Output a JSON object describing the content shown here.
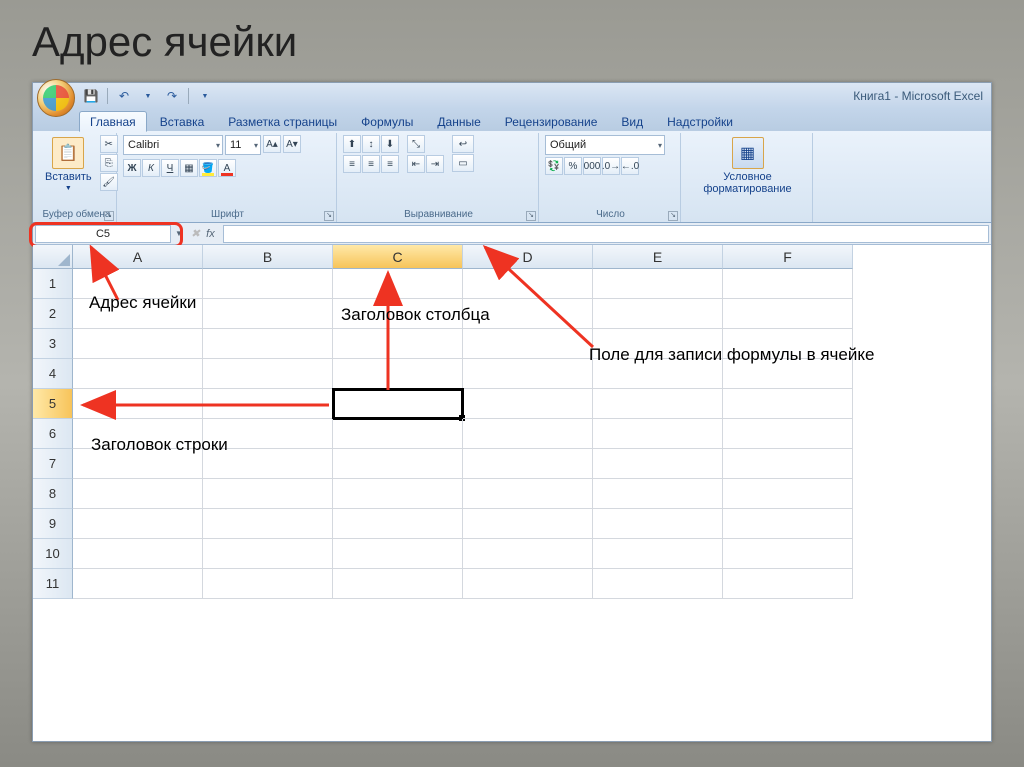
{
  "slide": {
    "title": "Адрес ячейки"
  },
  "titlebar": {
    "title": "Книга1 - Microsoft Excel"
  },
  "qat": {
    "save": "save",
    "undo": "undo",
    "redo": "redo"
  },
  "tabs": {
    "home": "Главная",
    "insert": "Вставка",
    "layout": "Разметка страницы",
    "formulas": "Формулы",
    "data": "Данные",
    "review": "Рецензирование",
    "view": "Вид",
    "addins": "Надстройки"
  },
  "ribbon": {
    "clipboard": {
      "paste": "Вставить",
      "label": "Буфер обмена"
    },
    "font": {
      "name": "Calibri",
      "size": "11",
      "label": "Шрифт",
      "bold": "Ж",
      "italic": "К",
      "underline": "Ч"
    },
    "align": {
      "label": "Выравнивание"
    },
    "number": {
      "format": "Общий",
      "label": "Число"
    },
    "cond": {
      "label": "Условное форматирование"
    }
  },
  "formula_row": {
    "name_box": "C5",
    "fx": "fx"
  },
  "sheet": {
    "columns": [
      "A",
      "B",
      "C",
      "D",
      "E",
      "F"
    ],
    "rows": [
      "1",
      "2",
      "3",
      "4",
      "5",
      "6",
      "7",
      "8",
      "9",
      "10",
      "11"
    ],
    "selected_col": "C",
    "selected_row": "5"
  },
  "annotations": {
    "addr": "Адрес ячейки",
    "col_header": "Заголовок столбца",
    "formula_field": "Поле для записи формулы в ячейке",
    "row_header": "Заголовок строки"
  }
}
